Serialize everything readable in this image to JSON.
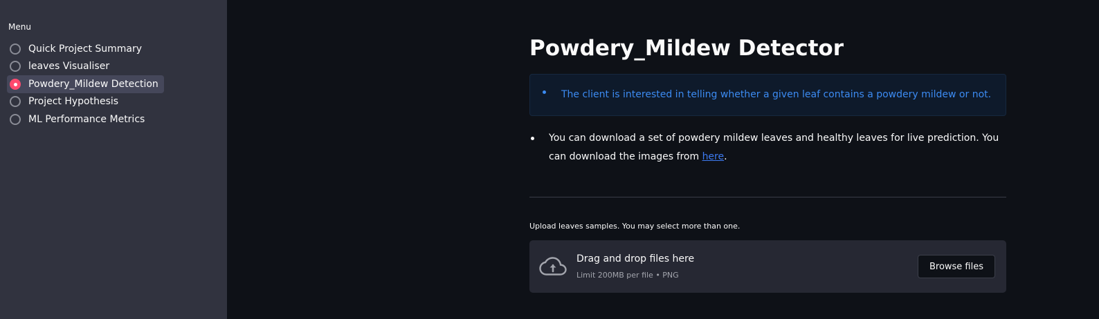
{
  "sidebar": {
    "menu_label": "Menu",
    "items": [
      {
        "label": "Quick Project Summary",
        "selected": false
      },
      {
        "label": "leaves Visualiser",
        "selected": false
      },
      {
        "label": "Powdery_Mildew Detection",
        "selected": true
      },
      {
        "label": "Project Hypothesis",
        "selected": false
      },
      {
        "label": "ML Performance Metrics",
        "selected": false
      }
    ]
  },
  "main": {
    "title": "Powdery_Mildew Detector",
    "info_text": "The client is interested in telling whether a given leaf contains a powdery mildew or not.",
    "body_text_before_link": "You can download a set of powdery mildew leaves and healthy leaves for live prediction. You can download the images from ",
    "body_link_text": "here",
    "body_text_after_link": ".",
    "upload_label": "Upload leaves samples. You may select more than one.",
    "dropzone": {
      "title": "Drag and drop files here",
      "limit": "Limit 200MB per file • PNG",
      "browse_label": "Browse files",
      "icon": "cloud-upload-icon"
    }
  },
  "colors": {
    "sidebar_bg": "#31333f",
    "main_bg": "#0e1117",
    "accent": "#ff4b6e",
    "info_text": "#3c8bf2",
    "link": "#3d7bf2"
  }
}
